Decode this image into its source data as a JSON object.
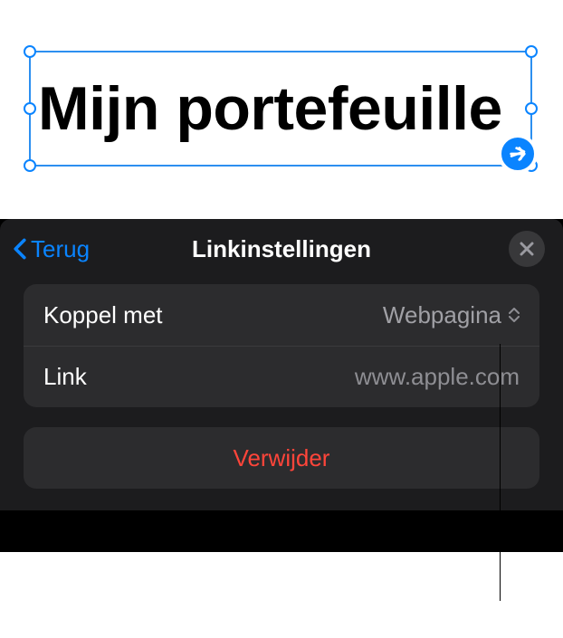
{
  "canvas": {
    "text": "Mijn portefeuille"
  },
  "panel": {
    "back_label": "Terug",
    "title": "Linkinstellingen",
    "rows": {
      "link_with_label": "Koppel met",
      "link_with_value": "Webpagina",
      "link_label": "Link",
      "link_placeholder": "www.apple.com"
    },
    "delete_label": "Verwijder"
  }
}
